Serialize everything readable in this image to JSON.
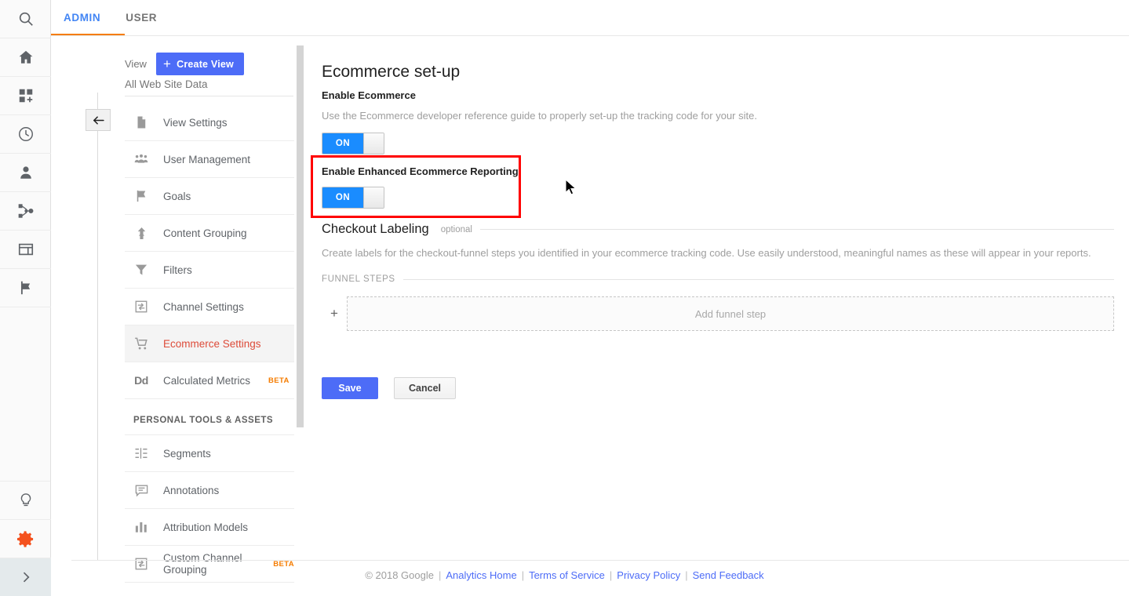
{
  "rail": {
    "items": [
      {
        "name": "search-icon",
        "label": "Search"
      },
      {
        "name": "home-icon",
        "label": "Home"
      },
      {
        "name": "customization-icon",
        "label": "Customization"
      },
      {
        "name": "realtime-clock-icon",
        "label": "Real-Time"
      },
      {
        "name": "audience-person-icon",
        "label": "Audience"
      },
      {
        "name": "acquisition-share-icon",
        "label": "Acquisition"
      },
      {
        "name": "behavior-window-icon",
        "label": "Behavior"
      },
      {
        "name": "conversions-flag-icon",
        "label": "Conversions"
      }
    ],
    "bottom": [
      {
        "name": "discover-bulb-icon",
        "label": "Discover"
      },
      {
        "name": "admin-gear-icon",
        "label": "Admin"
      },
      {
        "name": "expand-chevron-icon",
        "label": "Expand"
      }
    ],
    "accent_active": "#f4511e"
  },
  "tabs": {
    "items": [
      {
        "label": "ADMIN",
        "active": true
      },
      {
        "label": "USER",
        "active": false
      }
    ],
    "underline_color": "#f57c00",
    "active_color": "#4285f4"
  },
  "panel": {
    "view_label": "View",
    "create_view_button": "Create View",
    "create_view_icon": "plus-icon",
    "back_icon": "back-arrow-icon",
    "selected_view": "All Web Site Data",
    "menu": [
      {
        "label": "View Settings",
        "icon": "document-icon",
        "selected": false
      },
      {
        "label": "User Management",
        "icon": "people-icon",
        "selected": false
      },
      {
        "label": "Goals",
        "icon": "flag-icon",
        "selected": false
      },
      {
        "label": "Content Grouping",
        "icon": "content-grouping-icon",
        "selected": false
      },
      {
        "label": "Filters",
        "icon": "funnel-filter-icon",
        "selected": false
      },
      {
        "label": "Channel Settings",
        "icon": "channel-settings-icon",
        "selected": false
      },
      {
        "label": "Ecommerce Settings",
        "icon": "shopping-cart-icon",
        "selected": true
      },
      {
        "label": "Calculated Metrics",
        "icon": "dd-icon",
        "selected": false,
        "badge": "BETA"
      }
    ],
    "section_title": "PERSONAL TOOLS & ASSETS",
    "menu2": [
      {
        "label": "Segments",
        "icon": "segments-icon",
        "selected": false
      },
      {
        "label": "Annotations",
        "icon": "annotations-icon",
        "selected": false
      },
      {
        "label": "Attribution Models",
        "icon": "attribution-bars-icon",
        "selected": false
      },
      {
        "label": "Custom Channel Grouping",
        "icon": "channel-settings-icon",
        "selected": false,
        "badge": "BETA"
      }
    ]
  },
  "main": {
    "page_title": "Ecommerce set-up",
    "enable_ecommerce": {
      "label": "Enable Ecommerce",
      "description": "Use the Ecommerce developer reference guide to properly set-up the tracking code for your site.",
      "toggle_state": "ON"
    },
    "enhanced_ecommerce": {
      "label": "Enable Enhanced Ecommerce Reporting",
      "toggle_state": "ON",
      "highlight_color": "#ff0000"
    },
    "checkout_labeling": {
      "title": "Checkout Labeling",
      "optional": "optional",
      "description": "Create labels for the checkout-funnel steps you identified in your ecommerce tracking code. Use easily understood, meaningful names as these will appear in your reports.",
      "funnel_steps_header": "FUNNEL STEPS",
      "add_funnel_step": "Add funnel step",
      "add_icon": "plus-icon"
    },
    "buttons": {
      "save": "Save",
      "cancel": "Cancel",
      "save_color": "#4d6cf7"
    }
  },
  "footer": {
    "copyright": "© 2018 Google",
    "links": [
      "Analytics Home",
      "Terms of Service",
      "Privacy Policy",
      "Send Feedback"
    ],
    "separator": "|",
    "link_color": "#4d6cf7"
  }
}
